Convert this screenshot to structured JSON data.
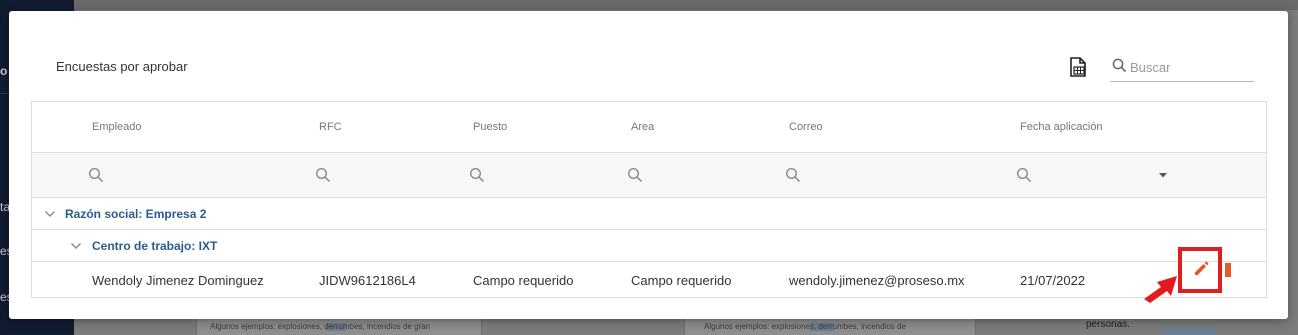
{
  "background": {
    "sidebar_fragments": [
      "o",
      "ta",
      "es",
      "es"
    ],
    "doc_texts": [
      "Algunos ejemplos: explosiones, derrumbes, incendios de gran",
      "Algunos ejemplos: explosiones, derrumbes, incendios de",
      "personas."
    ]
  },
  "toolbar": {
    "title": "Encuestas por aprobar",
    "export_icon": "excel-export-icon",
    "search_placeholder": "Buscar",
    "search_value": ""
  },
  "grid": {
    "columns": [
      "Empleado",
      "RFC",
      "Puesto",
      "Area",
      "Correo",
      "Fecha aplicación"
    ],
    "groups": [
      {
        "label": "Razón social: Empresa 2",
        "subgroups": [
          {
            "label": "Centro de trabajo: IXT",
            "rows": [
              {
                "empleado": "Wendoly Jimenez Dominguez",
                "rfc": "JIDW9612186L4",
                "puesto": "Campo requerido",
                "area": "Campo requerido",
                "correo": "wendoly.jimenez@proseso.mx",
                "fecha": "21/07/2022"
              }
            ]
          }
        ]
      }
    ]
  },
  "colors": {
    "accent_blue": "#2d5c8a",
    "edit_orange": "#e8531f",
    "highlight_red": "#e02020"
  }
}
